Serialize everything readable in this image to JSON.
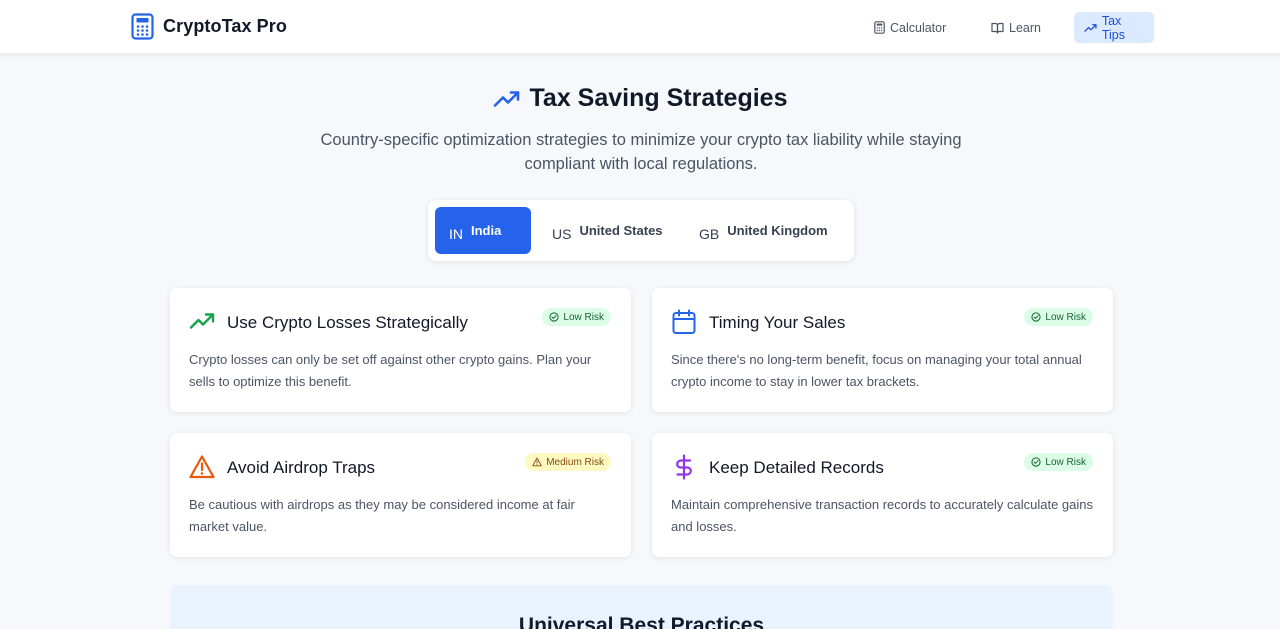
{
  "brand": {
    "name": "CryptoTax Pro",
    "icon": "calculator-icon",
    "color": "#2563eb"
  },
  "nav": {
    "items": [
      {
        "label": "Calculator",
        "icon": "calculator-icon",
        "active": false
      },
      {
        "label": "Learn",
        "icon": "book-icon",
        "active": false
      },
      {
        "label": "Tax Tips",
        "icon": "trending-up-icon",
        "active": true
      }
    ]
  },
  "hero": {
    "icon": "trending-up-icon",
    "title": "Tax Saving Strategies",
    "subtitle": "Country-specific optimization strategies to minimize your crypto tax liability while staying compliant with local regulations."
  },
  "countries": {
    "tabs": [
      {
        "code": "IN",
        "label": "India",
        "selected": true
      },
      {
        "code": "US",
        "label": "United States",
        "selected": false
      },
      {
        "code": "GB",
        "label": "United Kingdom",
        "selected": false
      }
    ]
  },
  "strategies": [
    {
      "icon": "trending-up-icon",
      "icon_color": "#16a34a",
      "title": "Use Crypto Losses Strategically",
      "description": "Crypto losses can only be set off against other crypto gains. Plan your sells to optimize this benefit.",
      "risk": "Low Risk",
      "risk_icon": "check-circle-icon"
    },
    {
      "icon": "calendar-icon",
      "icon_color": "#2563eb",
      "title": "Timing Your Sales",
      "description": "Since there's no long-term benefit, focus on managing your total annual crypto income to stay in lower tax brackets.",
      "risk": "Low Risk",
      "risk_icon": "check-circle-icon"
    },
    {
      "icon": "warning-triangle-icon",
      "icon_color": "#ea580c",
      "title": "Avoid Airdrop Traps",
      "description": "Be cautious with airdrops as they may be considered income at fair market value.",
      "risk": "Medium Risk",
      "risk_icon": "warning-triangle-icon"
    },
    {
      "icon": "dollar-icon",
      "icon_color": "#9333ea",
      "title": "Keep Detailed Records",
      "description": "Maintain comprehensive transaction records to accurately calculate gains and losses.",
      "risk": "Low Risk",
      "risk_icon": "check-circle-icon"
    }
  ],
  "best_practices": {
    "title": "Universal Best Practices"
  },
  "colors": {
    "accent": "#2563eb",
    "low_risk_bg": "#dcfce7",
    "low_risk_text": "#166534",
    "medium_risk_bg": "#fef9c3",
    "medium_risk_text": "#854d0e",
    "page_bg": "#f6f8fb"
  }
}
